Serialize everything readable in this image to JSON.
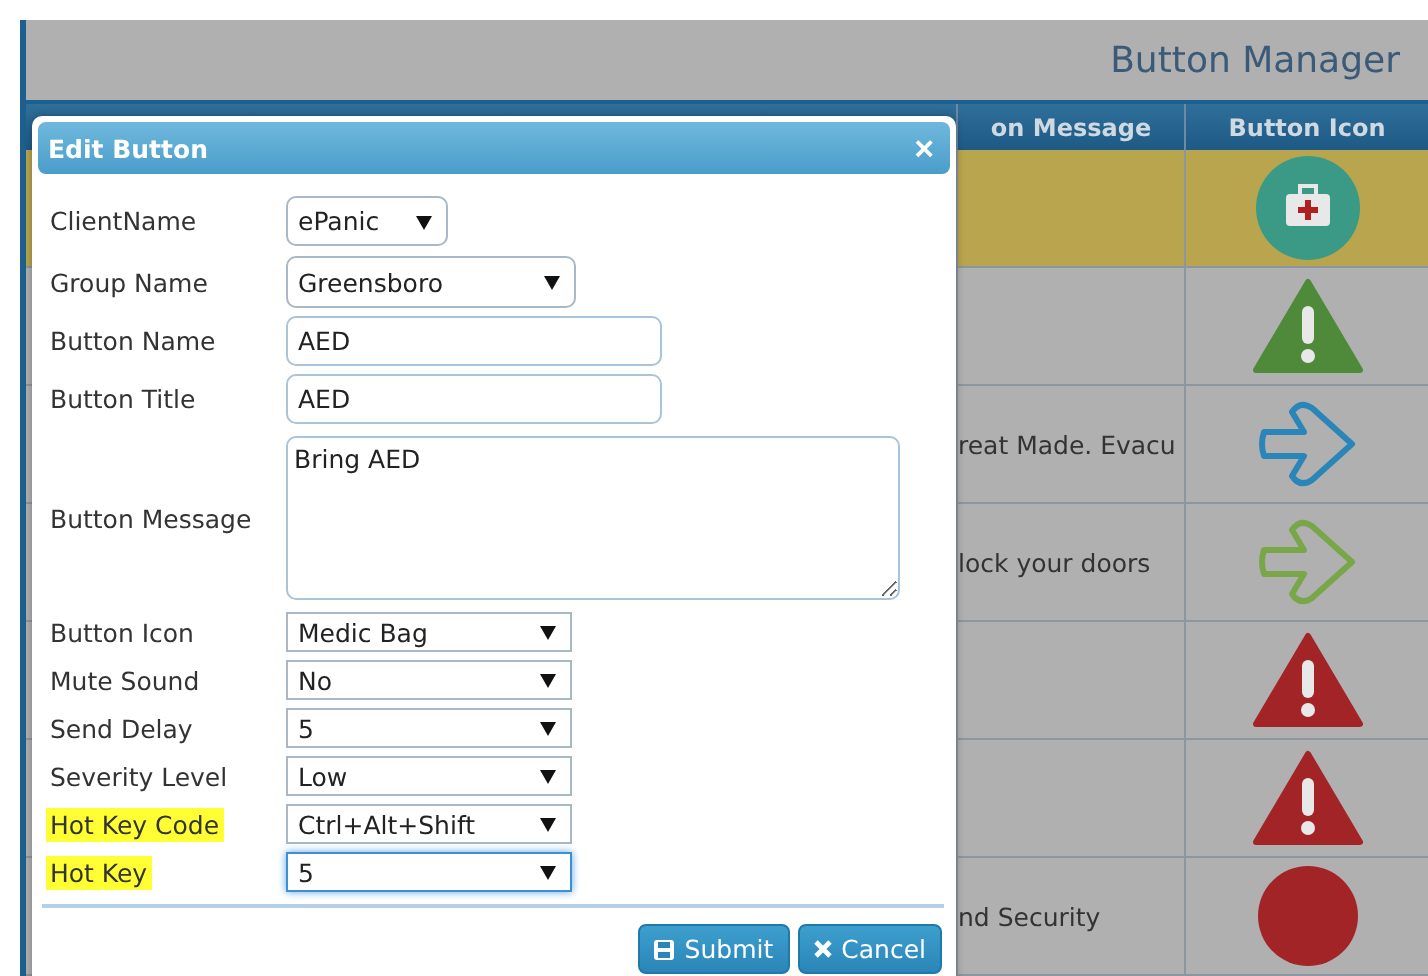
{
  "page": {
    "title": "Button Manager"
  },
  "table": {
    "columns": [
      "on Message",
      "Button Icon"
    ],
    "rows": [
      {
        "message": "",
        "kind": "medkit",
        "color": "#3a9a86",
        "selected": true
      },
      {
        "message": "",
        "kind": "warning",
        "color": "#4e8a3a",
        "selected": false
      },
      {
        "message": "reat Made. Evacu",
        "kind": "arrow",
        "color": "#2a86b8",
        "selected": false
      },
      {
        "message": "lock your doors",
        "kind": "arrow",
        "color": "#7aa64a",
        "selected": false
      },
      {
        "message": "",
        "kind": "warning",
        "color": "#a32426",
        "selected": false
      },
      {
        "message": "",
        "kind": "warning",
        "color": "#a32426",
        "selected": false
      },
      {
        "message": "nd Security",
        "kind": "circle",
        "color": "#a32426",
        "selected": false
      }
    ]
  },
  "dialog": {
    "title": "Edit Button",
    "close": "×",
    "fields": [
      {
        "label": "ClientName",
        "kind": "pill-select",
        "value": "ePanic",
        "highlighted": false,
        "focused": false
      },
      {
        "label": "Group Name",
        "kind": "wide-select",
        "value": "Greensboro",
        "highlighted": false,
        "focused": false
      },
      {
        "label": "Button Name",
        "kind": "input",
        "value": "AED",
        "highlighted": false,
        "focused": false
      },
      {
        "label": "Button Title",
        "kind": "input",
        "value": "AED",
        "highlighted": false,
        "focused": false
      },
      {
        "label": "Button Message",
        "kind": "textarea",
        "value": "Bring AED",
        "highlighted": false,
        "focused": false
      },
      {
        "label": "Button Icon",
        "kind": "select",
        "value": "Medic Bag",
        "highlighted": false,
        "focused": false
      },
      {
        "label": "Mute Sound",
        "kind": "select",
        "value": "No",
        "highlighted": false,
        "focused": false
      },
      {
        "label": "Send Delay",
        "kind": "select",
        "value": "5",
        "highlighted": false,
        "focused": false
      },
      {
        "label": "Severity Level",
        "kind": "select",
        "value": "Low",
        "highlighted": false,
        "focused": false
      },
      {
        "label": "Hot Key Code",
        "kind": "select",
        "value": "Ctrl+Alt+Shift",
        "highlighted": true,
        "focused": false
      },
      {
        "label": "Hot Key",
        "kind": "select",
        "value": "5",
        "highlighted": true,
        "focused": true
      }
    ],
    "buttons": [
      {
        "label": "Submit",
        "kind": "save"
      },
      {
        "label": "Cancel",
        "kind": "close"
      }
    ]
  }
}
